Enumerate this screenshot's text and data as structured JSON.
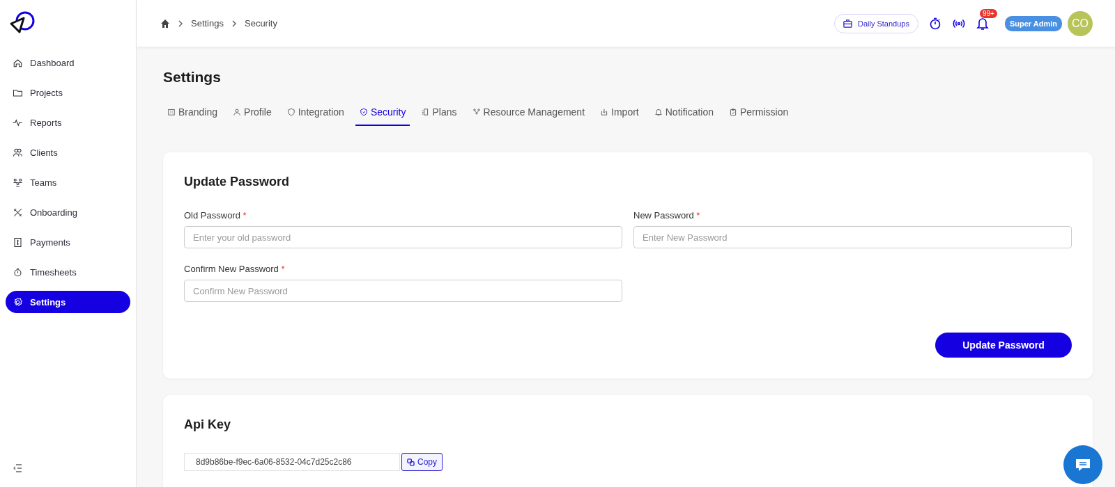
{
  "sidebar": {
    "items": [
      {
        "label": "Dashboard",
        "selected": false
      },
      {
        "label": "Projects",
        "selected": false
      },
      {
        "label": "Reports",
        "selected": false
      },
      {
        "label": "Clients",
        "selected": false
      },
      {
        "label": "Teams",
        "selected": false
      },
      {
        "label": "Onboarding",
        "selected": false
      },
      {
        "label": "Payments",
        "selected": false
      },
      {
        "label": "Timesheets",
        "selected": false
      },
      {
        "label": "Settings",
        "selected": true
      }
    ]
  },
  "breadcrumb": [
    "Settings",
    "Security"
  ],
  "header": {
    "standup_button": "Daily Standups",
    "notification_badge": "99+",
    "role_badge": "Super Admin",
    "avatar_initials": "CO"
  },
  "page_title": "Settings",
  "tabs": [
    {
      "label": "Branding",
      "selected": false
    },
    {
      "label": "Profile",
      "selected": false
    },
    {
      "label": "Integration",
      "selected": false
    },
    {
      "label": "Security",
      "selected": true
    },
    {
      "label": "Plans",
      "selected": false
    },
    {
      "label": "Resource Management",
      "selected": false
    },
    {
      "label": "Import",
      "selected": false
    },
    {
      "label": "Notification",
      "selected": false
    },
    {
      "label": "Permission",
      "selected": false
    }
  ],
  "password_card": {
    "title": "Update Password",
    "fields": [
      {
        "label": "Old Password",
        "required_mark": "*",
        "placeholder": "Enter your old password"
      },
      {
        "label": "New Password",
        "required_mark": "*",
        "placeholder": "Enter New Password"
      },
      {
        "label": "Confirm New Password",
        "required_mark": "*",
        "placeholder": "Confirm New Password"
      }
    ],
    "submit_button": "Update Password"
  },
  "api_card": {
    "title": "Api Key",
    "key_value": "8d9b86be-f9ec-6a06-8532-04c7d25c2c86",
    "copy_button": "Copy"
  }
}
